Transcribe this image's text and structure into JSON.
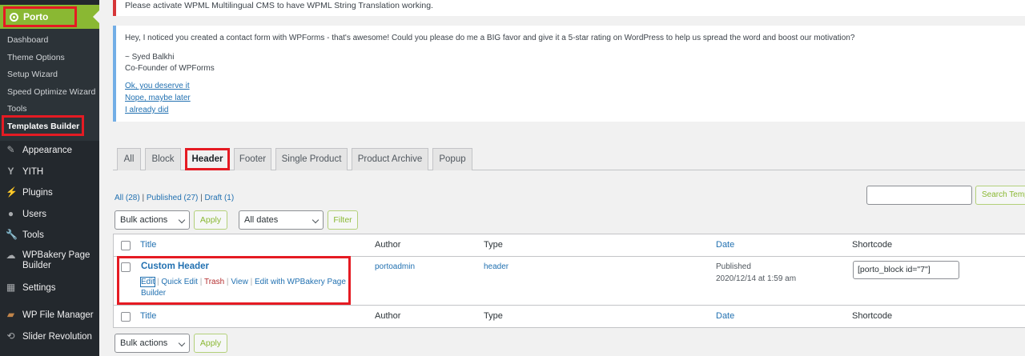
{
  "sidebar": {
    "porto_label": "Porto",
    "submenu": [
      {
        "label": "Dashboard"
      },
      {
        "label": "Theme Options"
      },
      {
        "label": "Setup Wizard"
      },
      {
        "label": "Speed Optimize Wizard"
      },
      {
        "label": "Tools"
      },
      {
        "label": "Templates Builder"
      }
    ],
    "menu": [
      {
        "label": "Appearance",
        "icon": "paintbrush-icon"
      },
      {
        "label": "YITH",
        "icon": "yith-icon"
      },
      {
        "label": "Plugins",
        "icon": "plugin-icon"
      },
      {
        "label": "Users",
        "icon": "users-icon"
      },
      {
        "label": "Tools",
        "icon": "wrench-icon"
      },
      {
        "label": "WPBakery Page Builder",
        "icon": "wpbakery-icon"
      },
      {
        "label": "Settings",
        "icon": "settings-icon"
      },
      {
        "label": "WP File Manager",
        "icon": "folder-icon"
      },
      {
        "label": "Slider Revolution",
        "icon": "refresh-icon"
      }
    ]
  },
  "notices": {
    "wpml": "Please activate WPML Multilingual CMS to have WPML String Translation working.",
    "wpforms_message": "Hey, I noticed you created a contact form with WPForms - that's awesome! Could you please do me a BIG favor and give it a 5-star rating on WordPress to help us spread the word and boost our motivation?",
    "signature_name": "~ Syed Balkhi",
    "signature_title": "Co-Founder of WPForms",
    "links": [
      "Ok, you deserve it",
      "Nope, maybe later",
      "I already did"
    ]
  },
  "tabs": [
    "All",
    "Block",
    "Header",
    "Footer",
    "Single Product",
    "Product Archive",
    "Popup"
  ],
  "active_tab": "Header",
  "status_links": {
    "all": "All (28)",
    "published": "Published (27)",
    "draft": "Draft (1)"
  },
  "search_button": "Search Templ",
  "filters": {
    "bulk_actions": "Bulk actions",
    "apply": "Apply",
    "all_dates": "All dates",
    "filter": "Filter"
  },
  "table": {
    "columns": [
      "Title",
      "Author",
      "Type",
      "Date",
      "Shortcode"
    ],
    "row": {
      "title": "Custom Header",
      "actions": [
        "Edit",
        "Quick Edit",
        "Trash",
        "View",
        "Edit with WPBakery Page Builder"
      ],
      "author": "portoadmin",
      "type": "header",
      "status": "Published",
      "date": "2020/12/14 at 1:59 am",
      "shortcode": "[porto_block id=\"7\"]"
    }
  },
  "colors": {
    "accent": "#8ab833",
    "highlight_border": "#e51b23",
    "sidebar_bg": "#23282d",
    "link": "#2271b1"
  }
}
